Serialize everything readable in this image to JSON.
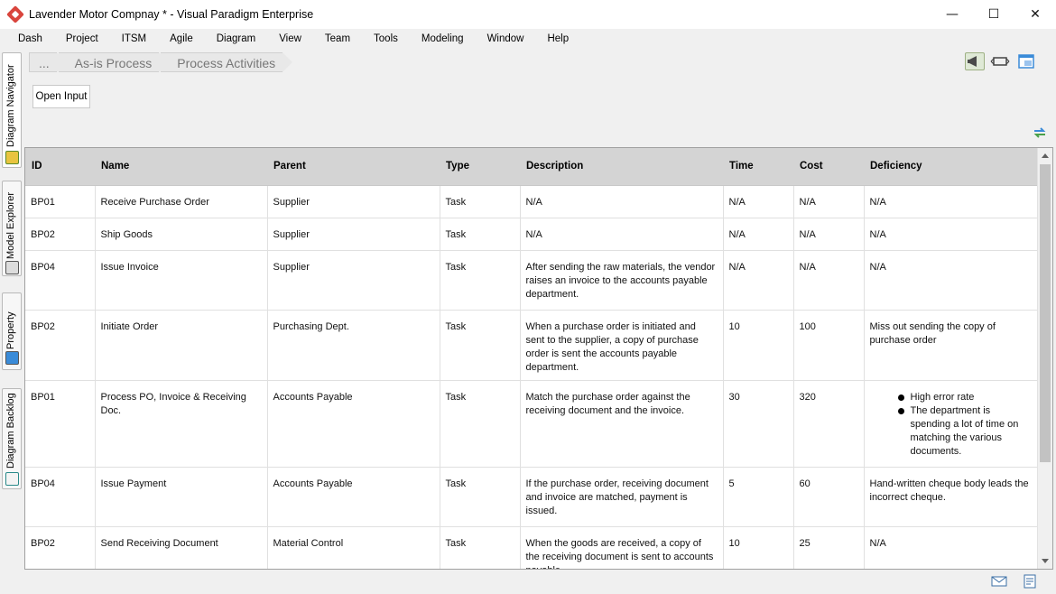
{
  "window": {
    "title": "Lavender Motor Compnay * - Visual Paradigm Enterprise",
    "minimize": "—",
    "maximize": "☐",
    "close": "✕"
  },
  "menu": [
    "Dash",
    "Project",
    "ITSM",
    "Agile",
    "Diagram",
    "View",
    "Team",
    "Tools",
    "Modeling",
    "Window",
    "Help"
  ],
  "left_tabs": [
    "Diagram Navigator",
    "Model Explorer",
    "Property",
    "Diagram Backlog"
  ],
  "breadcrumb": [
    "...",
    "As-is Process",
    "Process Activities"
  ],
  "open_input_label": "Open Input",
  "table": {
    "headers": [
      "ID",
      "Name",
      "Parent",
      "Type",
      "Description",
      "Time",
      "Cost",
      "Deficiency"
    ],
    "rows": [
      {
        "id": "BP01",
        "name": "Receive Purchase Order",
        "parent": "Supplier",
        "type": "Task",
        "description": "N/A",
        "time": "N/A",
        "cost": "N/A",
        "deficiency": "N/A"
      },
      {
        "id": "BP02",
        "name": "Ship Goods",
        "parent": "Supplier",
        "type": "Task",
        "description": "N/A",
        "time": "N/A",
        "cost": "N/A",
        "deficiency": "N/A"
      },
      {
        "id": "BP04",
        "name": "Issue Invoice",
        "parent": "Supplier",
        "type": "Task",
        "description": "After sending the raw materials, the vendor raises an invoice to the accounts payable department.",
        "time": "N/A",
        "cost": "N/A",
        "deficiency": "N/A"
      },
      {
        "id": "BP02",
        "name": "Initiate Order",
        "parent": "Purchasing Dept.",
        "type": "Task",
        "description": "When a purchase order is initiated and sent to the supplier, a copy of purchase order is sent the accounts payable department.",
        "time": "10",
        "cost": "100",
        "deficiency": "Miss out sending the copy of purchase order"
      },
      {
        "id": "BP01",
        "name": "Process PO, Invoice & Receiving Doc.",
        "parent": "Accounts Payable",
        "type": "Task",
        "description": "Match the purchase order against the receiving document and the invoice.",
        "time": "30",
        "cost": "320",
        "deficiency_list": [
          "High error rate",
          "The department is spending a lot of time on matching the various documents."
        ]
      },
      {
        "id": "BP04",
        "name": "Issue Payment",
        "parent": "Accounts Payable",
        "type": "Task",
        "description": "If the purchase order, receiving document and invoice are matched, payment is issued.",
        "time": "5",
        "cost": "60",
        "deficiency": "Hand-written cheque body leads the incorrect cheque."
      },
      {
        "id": "BP02",
        "name": "Send Receiving Document",
        "parent": "Material Control",
        "type": "Task",
        "description": "When the goods are received, a copy of the receiving document is sent to accounts payable.",
        "time": "10",
        "cost": "25",
        "deficiency": "N/A"
      }
    ]
  },
  "colors": {
    "header_bg": "#d4d4d4",
    "app_icon": "#d9453d",
    "toolbar_accent": "#3a8bd8"
  },
  "icons": [
    "app-logo-icon",
    "megaphone-icon",
    "fit-width-icon",
    "layout-icon",
    "refresh-icon",
    "mail-icon",
    "note-icon"
  ]
}
